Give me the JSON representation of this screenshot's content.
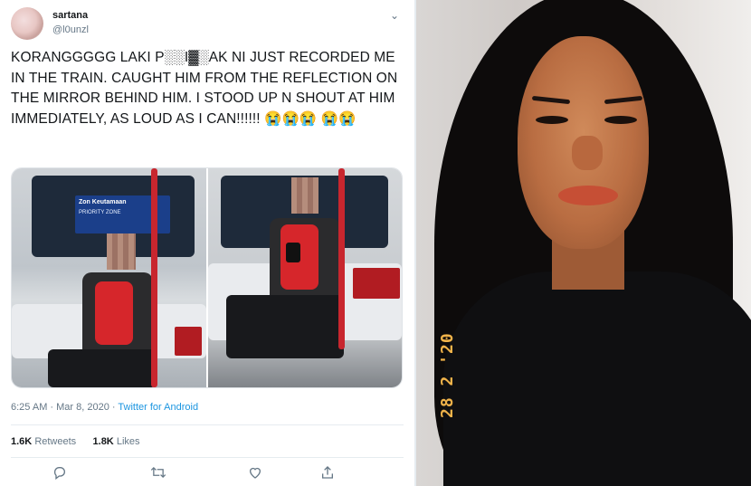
{
  "tweet": {
    "display_name": "sartana",
    "handle": "@l0unzl",
    "text": "KORANGGGGG LAKI P░░I▓░AK NI JUST RECORDED ME IN THE TRAIN. CAUGHT HIM FROM THE REFLECTION ON THE MIRROR BEHIND HIM. I STOOD UP N SHOUT AT HIM IMMEDIATELY, AS LOUD AS I CAN!!!!!! 😭😭😭 😭😭",
    "timestamp": "6:25 AM · Mar 8, 2020",
    "separator": " · ",
    "source": "Twitter for Android",
    "retweets_count": "1.6K",
    "retweets_label": "Retweets",
    "likes_count": "1.8K",
    "likes_label": "Likes",
    "media_signs": {
      "zone_label": "Zon Keutamaan",
      "priority_label": "PRIORITY ZONE"
    }
  },
  "icons": {
    "menu": "chevron-down-icon",
    "reply": "reply-icon",
    "retweet": "retweet-icon",
    "like": "heart-icon",
    "share": "share-icon"
  },
  "selfie": {
    "date_stamp": "28 2 '20"
  },
  "colors": {
    "link": "#1b95e0",
    "text": "#14171a",
    "muted": "#657786",
    "stamp": "#f0b34a"
  }
}
